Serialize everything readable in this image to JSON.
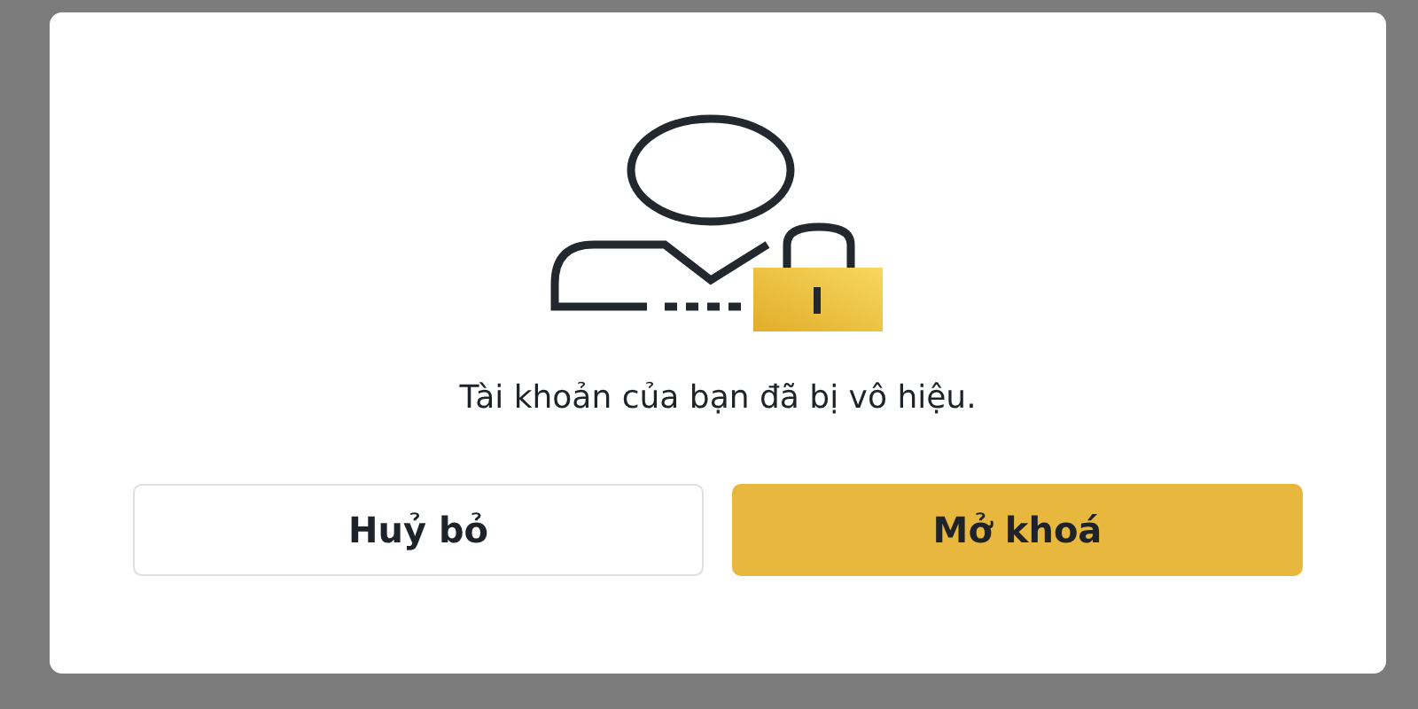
{
  "dialog": {
    "message": "Tài khoản của bạn đã bị vô hiệu.",
    "buttons": [
      {
        "label": "Huỷ bỏ",
        "kind": "secondary"
      },
      {
        "label": "Mở khoá",
        "kind": "primary"
      }
    ]
  }
}
